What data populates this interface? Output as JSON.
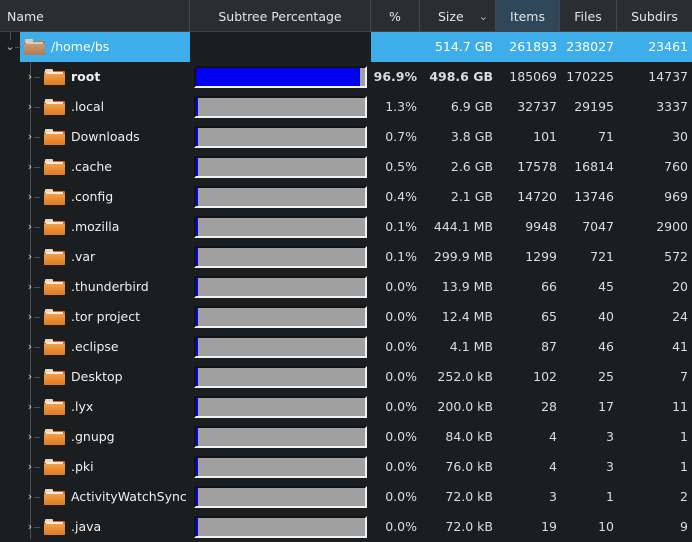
{
  "columns": [
    {
      "key": "name",
      "label": "Name"
    },
    {
      "key": "subtree",
      "label": "Subtree Percentage"
    },
    {
      "key": "pct",
      "label": "%"
    },
    {
      "key": "size",
      "label": "Size",
      "sort": "descending"
    },
    {
      "key": "items",
      "label": "Items",
      "highlighted": true
    },
    {
      "key": "files",
      "label": "Files"
    },
    {
      "key": "subdirs",
      "label": "Subdirs"
    }
  ],
  "root": {
    "name": "/home/bs",
    "expanded": true,
    "selected": true,
    "size": "514.7 GB",
    "items": "261893",
    "files": "238027",
    "subdirs": "23461"
  },
  "children": [
    {
      "name": "root",
      "pct": "96.9%",
      "subtree_fraction": 0.969,
      "size": "498.6 GB",
      "items": "185069",
      "files": "170225",
      "subdirs": "14737",
      "bold": true
    },
    {
      "name": ".local",
      "pct": "1.3%",
      "subtree_fraction": 0.013,
      "size": "6.9 GB",
      "items": "32737",
      "files": "29195",
      "subdirs": "3337"
    },
    {
      "name": "Downloads",
      "pct": "0.7%",
      "subtree_fraction": 0.007,
      "size": "3.8 GB",
      "items": "101",
      "files": "71",
      "subdirs": "30"
    },
    {
      "name": ".cache",
      "pct": "0.5%",
      "subtree_fraction": 0.005,
      "size": "2.6 GB",
      "items": "17578",
      "files": "16814",
      "subdirs": "760"
    },
    {
      "name": ".config",
      "pct": "0.4%",
      "subtree_fraction": 0.004,
      "size": "2.1 GB",
      "items": "14720",
      "files": "13746",
      "subdirs": "969"
    },
    {
      "name": ".mozilla",
      "pct": "0.1%",
      "subtree_fraction": 0.001,
      "size": "444.1 MB",
      "items": "9948",
      "files": "7047",
      "subdirs": "2900"
    },
    {
      "name": ".var",
      "pct": "0.1%",
      "subtree_fraction": 0.001,
      "size": "299.9 MB",
      "items": "1299",
      "files": "721",
      "subdirs": "572"
    },
    {
      "name": ".thunderbird",
      "pct": "0.0%",
      "subtree_fraction": 0.0,
      "size": "13.9 MB",
      "items": "66",
      "files": "45",
      "subdirs": "20"
    },
    {
      "name": ".tor project",
      "pct": "0.0%",
      "subtree_fraction": 0.0,
      "size": "12.4 MB",
      "items": "65",
      "files": "40",
      "subdirs": "24"
    },
    {
      "name": ".eclipse",
      "pct": "0.0%",
      "subtree_fraction": 0.0,
      "size": "4.1 MB",
      "items": "87",
      "files": "46",
      "subdirs": "41"
    },
    {
      "name": "Desktop",
      "pct": "0.0%",
      "subtree_fraction": 0.0,
      "size": "252.0 kB",
      "items": "102",
      "files": "25",
      "subdirs": "7"
    },
    {
      "name": ".lyx",
      "pct": "0.0%",
      "subtree_fraction": 0.0,
      "size": "200.0 kB",
      "items": "28",
      "files": "17",
      "subdirs": "11"
    },
    {
      "name": ".gnupg",
      "pct": "0.0%",
      "subtree_fraction": 0.0,
      "size": "84.0 kB",
      "items": "4",
      "files": "3",
      "subdirs": "1"
    },
    {
      "name": ".pki",
      "pct": "0.0%",
      "subtree_fraction": 0.0,
      "size": "76.0 kB",
      "items": "4",
      "files": "3",
      "subdirs": "1"
    },
    {
      "name": "ActivityWatchSync",
      "pct": "0.0%",
      "subtree_fraction": 0.0,
      "size": "72.0 kB",
      "items": "3",
      "files": "1",
      "subdirs": "2"
    },
    {
      "name": ".java",
      "pct": "0.0%",
      "subtree_fraction": 0.0,
      "size": "72.0 kB",
      "items": "19",
      "files": "10",
      "subdirs": "9"
    }
  ],
  "icons": {
    "expanded": "chevron-down-icon",
    "collapsed": "chevron-right-icon",
    "folder": "folder-icon",
    "sort": "sort-descending-icon"
  },
  "colors": {
    "selection": "#3daee9",
    "bar_fill": "#0000f0",
    "bar_empty": "#a0a0a0",
    "folder": "#e07a22",
    "background": "#1b1e20",
    "header_bg": "#2a2e32",
    "highlighted_header": "#2f4758"
  }
}
